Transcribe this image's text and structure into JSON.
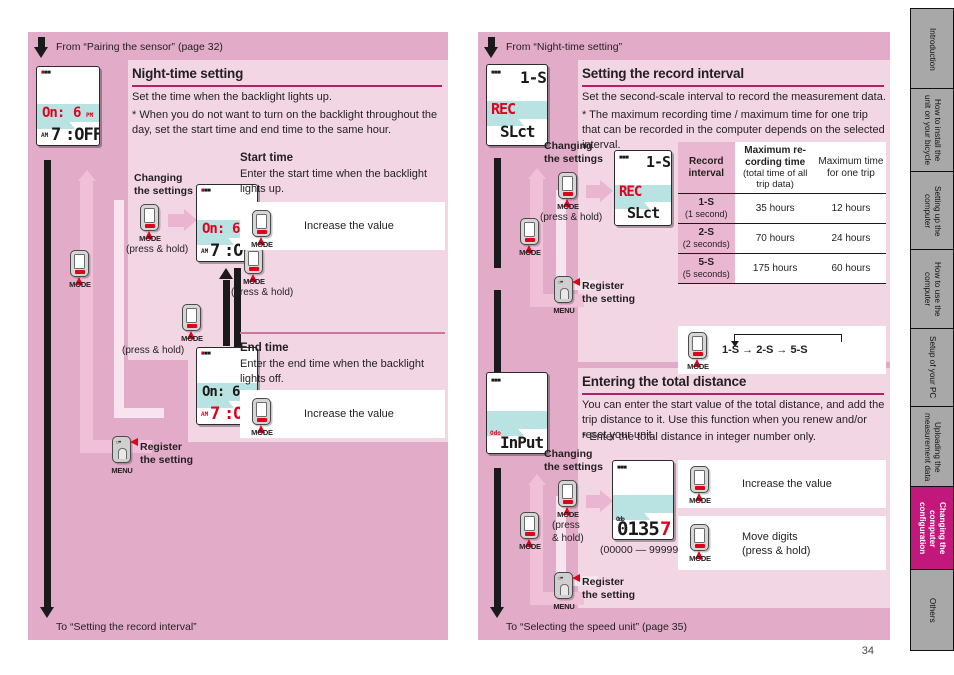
{
  "page": {
    "number": "34"
  },
  "colors": {
    "panel_pink": "#e2abc8",
    "content_pink": "#f2d6e4",
    "accent_magenta": "#b3216b",
    "active_tab": "#c2187c",
    "lcd_band": "#b9e3e2",
    "lcd_red": "#e2001a"
  },
  "left_panel": {
    "from_label": "From “Pairing the sensor” (page 32)",
    "to_label": "To “Setting the record interval”",
    "section": {
      "title": "Night-time setting",
      "desc": "Set the time when the backlight lights up.",
      "note": "* When you do not want to turn on the backlight throughout the day, set the start time and end time to the same hour."
    },
    "lcd_main": {
      "line1": "On:",
      "line2": "6",
      "suffix1": "PM",
      "prefix2": "AM",
      "line3": "7",
      "line4": ":OFF"
    },
    "changing_label": "Changing\nthe settings",
    "mode_button": {
      "label": "MODE",
      "hold": "(press & hold)"
    },
    "mode_button_plain": {
      "label": "MODE"
    },
    "steps": [
      {
        "title": "Start time",
        "desc": "Enter the start time when the backlight lights up.",
        "action": "Increase the value",
        "action_button": "MODE"
      },
      {
        "title": "End time",
        "desc": "Enter the end time when the backlight lights off.",
        "action": "Increase the value",
        "action_button": "MODE"
      }
    ],
    "register": {
      "label": "Register\nthe setting",
      "button": "MENU"
    }
  },
  "right_panel": {
    "from_label": "From “Night-time setting”",
    "to_label": "To “Selecting the speed unit” (page 35)",
    "section1": {
      "title": "Setting the record interval",
      "desc": "Set the second-scale interval to record the measurement data.",
      "note": "* The maximum recording time / maximum time for one trip that can be recorded in the computer depends on the selected interval."
    },
    "lcd_rec": {
      "top": "1-S",
      "band": "REC",
      "bottom": "SLct"
    },
    "table": {
      "headers": [
        "Record\ninterval",
        "Maximum re-\ncording time",
        "Maximum time\nfor one trip"
      ],
      "header2_sub": "(total time of all trip data)",
      "rows": [
        {
          "interval": "1-S",
          "interval_sub": "(1 second)",
          "max_rec": "35 hours",
          "max_trip": "12 hours"
        },
        {
          "interval": "2-S",
          "interval_sub": "(2 seconds)",
          "max_rec": "70 hours",
          "max_trip": "24 hours"
        },
        {
          "interval": "5-S",
          "interval_sub": "(5 seconds)",
          "max_rec": "175 hours",
          "max_trip": "60 hours"
        }
      ]
    },
    "loop": {
      "sequence": "1-S → 2-S → 5-S",
      "button": "MODE"
    },
    "section2": {
      "title": "Entering the total distance",
      "desc": "You can enter the start value of the total distance, and add the trip distance to it. Use this function when you renew and/or reset your unit.",
      "note": "* Enter the total distance in integer number only."
    },
    "lcd_input": {
      "label": "Odo",
      "text": "InPut"
    },
    "lcd_odo": {
      "label": "Odo",
      "digits": "0135",
      "last_digit": "7",
      "range": "(00000 — 99999)"
    },
    "changing_label": "Changing\nthe settings",
    "mode_button": {
      "label": "MODE",
      "hold": "(press\n& hold)"
    },
    "actions": [
      {
        "text": "Increase the value",
        "button": "MODE"
      },
      {
        "text": "Move digits\n(press & hold)",
        "button": "MODE"
      }
    ],
    "register": {
      "label": "Register\nthe setting",
      "button": "MENU"
    }
  },
  "sidebar": {
    "tabs": [
      {
        "label": "Introduction",
        "active": false
      },
      {
        "label": "How to install the\nunit on your bicycle",
        "active": false
      },
      {
        "label": "Setting up the\ncomputer",
        "active": false
      },
      {
        "label": "How to use the\ncomputer",
        "active": false
      },
      {
        "label": "Setup of your PC",
        "active": false
      },
      {
        "label": "Uploading the\nmeasurement data",
        "active": false
      },
      {
        "label": "Changing the\ncomputer\nconfiguration",
        "active": true
      },
      {
        "label": "Others",
        "active": false
      }
    ]
  }
}
